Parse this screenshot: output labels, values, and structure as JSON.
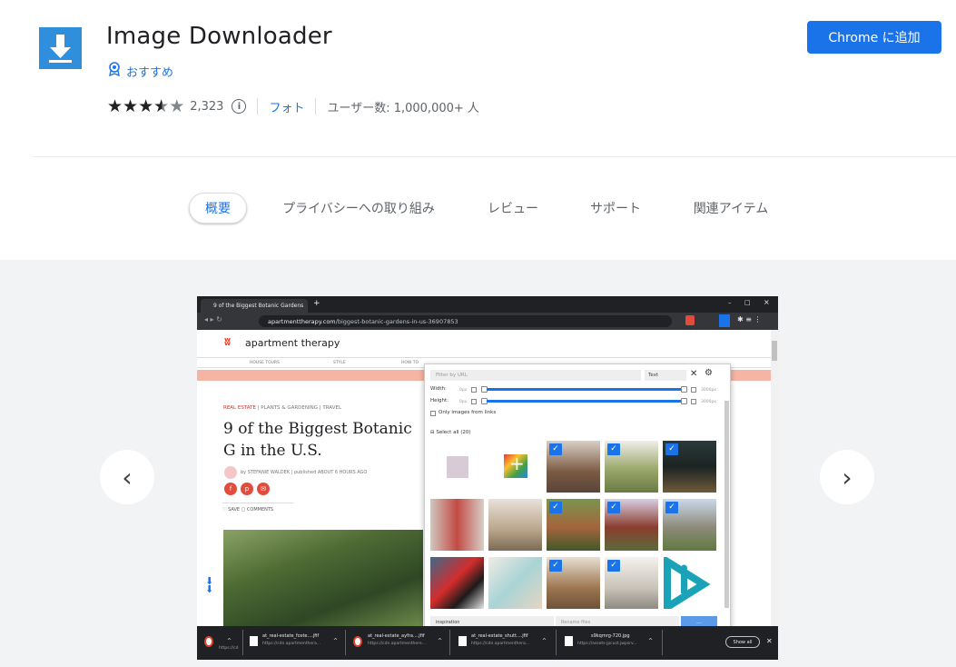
{
  "listing": {
    "title": "Image Downloader",
    "featured_label": "おすすめ",
    "rating_count": "2,323",
    "category": "フォト",
    "users": "ユーザー数: 1,000,000+ 人",
    "add_button": "Chrome に追加",
    "rating_value": 3.5
  },
  "tabs": [
    "概要",
    "プライバシーへの取り組み",
    "レビュー",
    "サポート",
    "関連アイテム"
  ],
  "gallery": {
    "prev_icon": "‹",
    "next_icon": "›",
    "browser": {
      "tab_title": "9 of the Biggest Botanic Gardens",
      "url_host": "apartmenttherapy.com",
      "url_path": "/biggest-botanic-gardens-in-us-36907853",
      "site_name": "apartment therapy",
      "nav": [
        "HOUSE TOURS",
        "STYLE",
        "HOW TO"
      ],
      "tags_real_estate": "REAL ESTATE",
      "tags_rest": "| PLANTS & GARDENING | TRAVEL",
      "headline": "9 of the Biggest Botanic G in the U.S.",
      "byline": "by STEFANIE WALDEK | published ABOUT 6 HOURS AGO",
      "save": "♡ SAVE    ▢ COMMENTS"
    },
    "popup": {
      "filter_placeholder": "Filter by URL",
      "filter_mode": "Text",
      "width_label": "Width:",
      "height_label": "Height:",
      "min_px": "0px",
      "max_px": "3000px",
      "only_links": "Only images from links",
      "select_all": "Select all (20)",
      "dir_value": "inspiration",
      "rename_placeholder": "Rename files",
      "download_button": "..."
    },
    "downloads": [
      {
        "name": "",
        "url": "https://cd"
      },
      {
        "name": "at_real-estate_foste....jfif",
        "url": "https://cdn.apartmenthera..."
      },
      {
        "name": "at_real-estate_ayfra....jfif",
        "url": "https://cdn.apartmenthere..."
      },
      {
        "name": "at_real-estate_shutt....jfif",
        "url": "https://cdn.apartmenthera..."
      },
      {
        "name": "s9kqmrg-720.jpg",
        "url": "https://assets-jpcust.jwpsrv..."
      }
    ],
    "show_all": "Show all"
  },
  "colors": {
    "accent": "#1a73e8",
    "icon_blue": "#2f8fdd",
    "gallery_bg": "#f1f3f4"
  }
}
